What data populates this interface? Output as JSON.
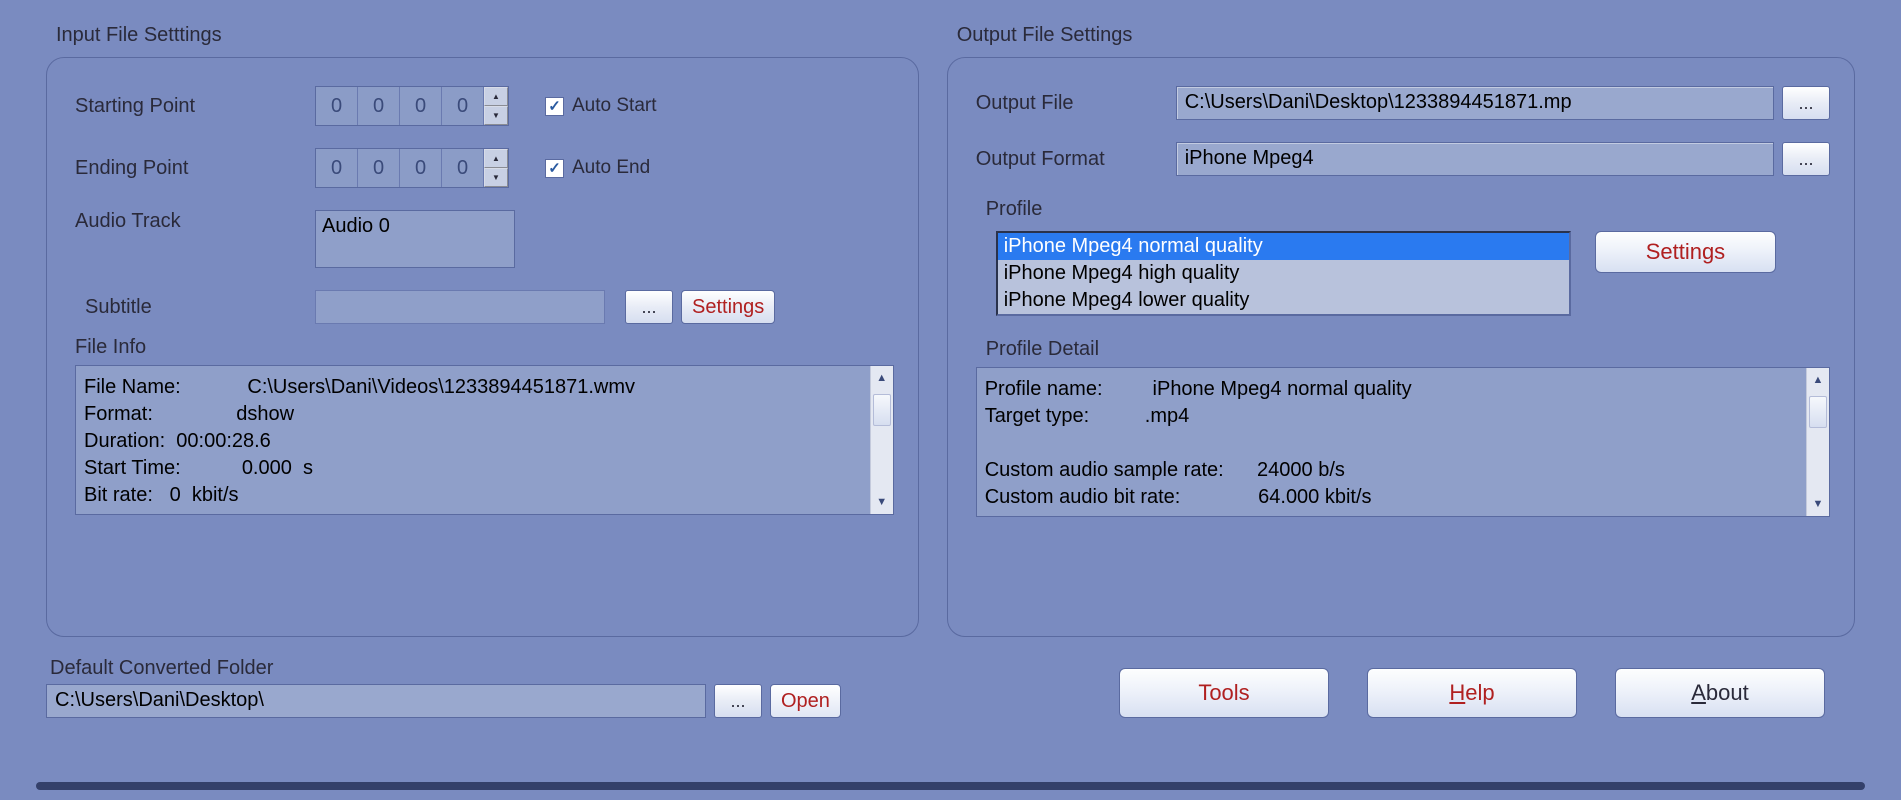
{
  "input": {
    "title": "Input File Setttings",
    "starting_point_label": "Starting Point",
    "starting_point": [
      "0",
      "0",
      "0",
      "0"
    ],
    "auto_start_label": "Auto Start",
    "auto_start_checked": true,
    "ending_point_label": "Ending Point",
    "ending_point": [
      "0",
      "0",
      "0",
      "0"
    ],
    "auto_end_label": "Auto End",
    "auto_end_checked": true,
    "audio_track_label": "Audio Track",
    "audio_track_value": "Audio 0",
    "subtitle_label": "Subtitle",
    "subtitle_value": "",
    "browse_label": "...",
    "settings_label": "Settings",
    "file_info_title": "File Info",
    "file_info_text": "File Name:            C:\\Users\\Dani\\Videos\\1233894451871.wmv\nFormat:               dshow\nDuration:  00:00:28.6\nStart Time:           0.000  s\nBit rate:   0  kbit/s"
  },
  "output": {
    "title": "Output File Settings",
    "output_file_label": "Output File",
    "output_file_value": "C:\\Users\\Dani\\Desktop\\1233894451871.mp",
    "output_format_label": "Output Format",
    "output_format_value": "iPhone Mpeg4",
    "browse_label": "...",
    "profile_label": "Profile",
    "profiles": [
      "iPhone Mpeg4 normal quality",
      "iPhone Mpeg4 high quality",
      "iPhone Mpeg4 lower quality"
    ],
    "profile_selected_index": 0,
    "settings_label": "Settings",
    "profile_detail_title": "Profile Detail",
    "profile_detail_text": "Profile name:         iPhone Mpeg4 normal quality\nTarget type:          .mp4\n\nCustom audio sample rate:      24000 b/s\nCustom audio bit rate:              64.000 kbit/s"
  },
  "footer": {
    "default_folder_label": "Default Converted Folder",
    "default_folder_value": "C:\\Users\\Dani\\Desktop\\",
    "browse_label": "...",
    "open_label": "Open",
    "tools_label": "Tools",
    "help_label": "Help",
    "about_label": "About"
  }
}
